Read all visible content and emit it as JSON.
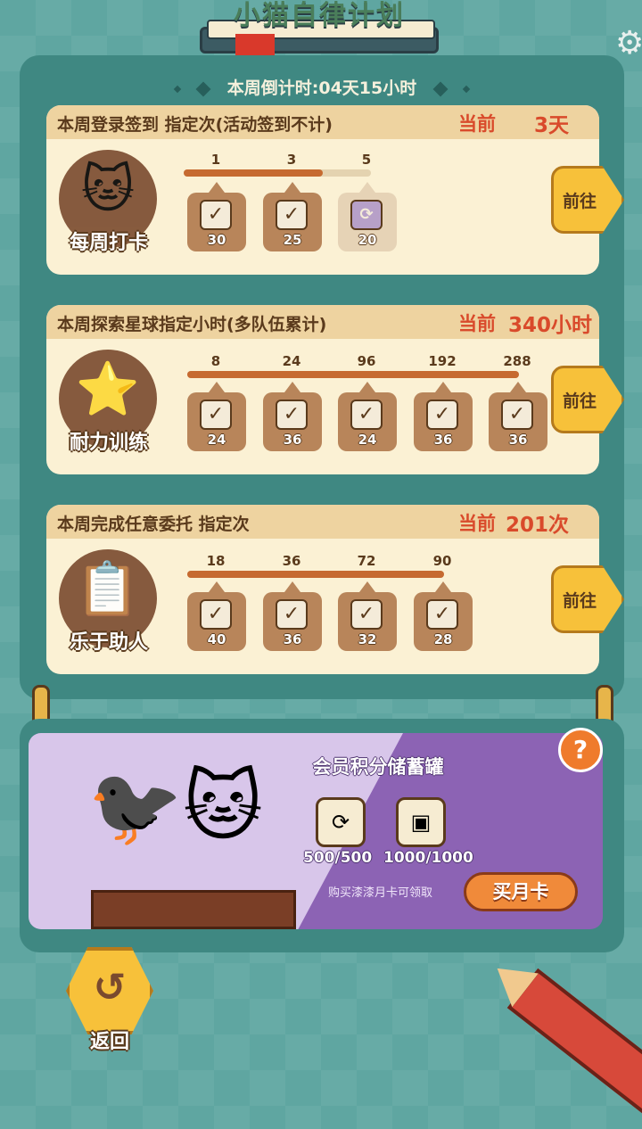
{
  "header": {
    "title": "小猫自律计划",
    "countdown": "本周倒计时:04天15小时"
  },
  "tasks": [
    {
      "description": "本周登录签到 指定次(活动签到不计)",
      "current_label": "当前",
      "current_value": "3天",
      "icon_name": "sleeping-cat-icon",
      "icon_label": "每周打卡",
      "progress_fraction": 0.6,
      "milestones": [
        "1",
        "3",
        "5"
      ],
      "rewards": [
        {
          "amount": "30",
          "claimed": true
        },
        {
          "amount": "25",
          "claimed": true
        },
        {
          "amount": "20",
          "claimed": false
        }
      ],
      "go_label": "前往"
    },
    {
      "description": "本周探索星球指定小时(多队伍累计)",
      "current_label": "当前",
      "current_value": "340小时",
      "icon_name": "stars-cave-icon",
      "icon_label": "耐力训练",
      "progress_fraction": 1.0,
      "milestones": [
        "8",
        "24",
        "96",
        "192",
        "288"
      ],
      "rewards": [
        {
          "amount": "24",
          "claimed": true
        },
        {
          "amount": "36",
          "claimed": true
        },
        {
          "amount": "24",
          "claimed": true
        },
        {
          "amount": "36",
          "claimed": true
        },
        {
          "amount": "36",
          "claimed": true
        }
      ],
      "go_label": "前往"
    },
    {
      "description": "本周完成任意委托 指定次",
      "current_label": "当前",
      "current_value": "201次",
      "icon_name": "clipboard-check-icon",
      "icon_label": "乐于助人",
      "progress_fraction": 1.0,
      "milestones": [
        "18",
        "36",
        "72",
        "90"
      ],
      "rewards": [
        {
          "amount": "40",
          "claimed": true
        },
        {
          "amount": "36",
          "claimed": true
        },
        {
          "amount": "32",
          "claimed": true
        },
        {
          "amount": "28",
          "claimed": true
        }
      ],
      "go_label": "前往"
    }
  ],
  "piggy_bank": {
    "title": "会员积分储蓄罐",
    "progress_1": "500/500",
    "progress_2": "1000/1000",
    "hint": "购买漆漆月卡可领取",
    "buy_label": "买月卡",
    "help_label": "?"
  },
  "back_label": "返回",
  "colors": {
    "accent": "#f7c13a",
    "panel": "#3f8882",
    "card": "#fbf1d4",
    "highlight": "#d94a2b",
    "purple": "#8c63b4"
  }
}
